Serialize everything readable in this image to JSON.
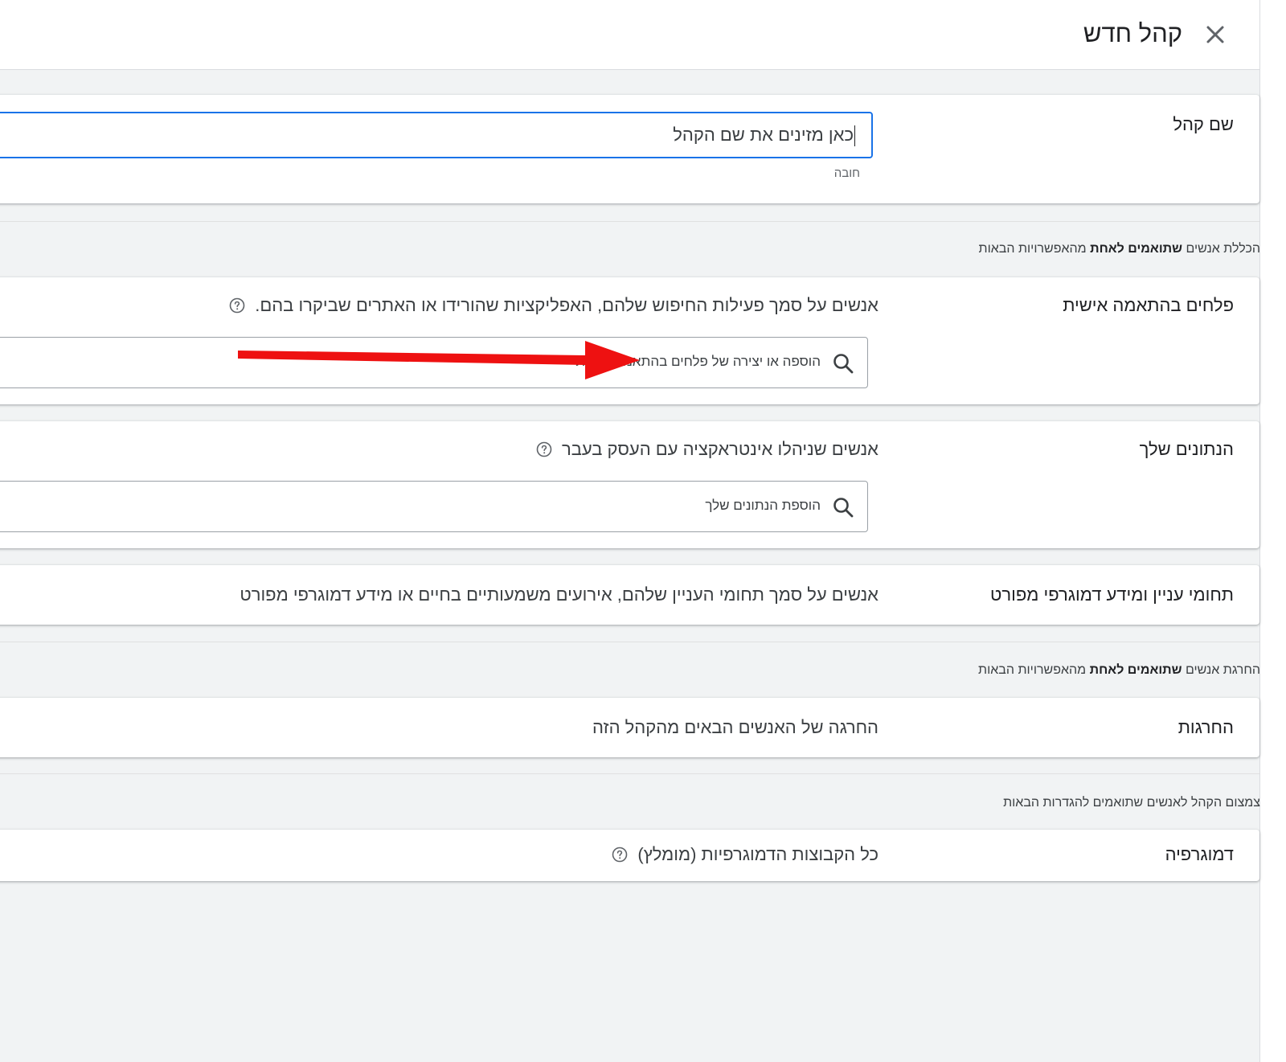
{
  "header": {
    "title": "קהל חדש",
    "close_icon": "close-icon"
  },
  "audience_name": {
    "label": "שם קהל",
    "value": "כאן מזינים את שם הקהל",
    "hint": "חובה"
  },
  "include_label": {
    "prefix": "הכללת אנשים ",
    "bold": "שתואמים לאחת",
    "suffix": " מהאפשרויות הבאות"
  },
  "custom_segments": {
    "title": "פלחים בהתאמה אישית",
    "description": "אנשים על סמך פעילות החיפוש שלהם, האפליקציות שהורידו או האתרים שביקרו בהם.",
    "search_placeholder": "הוספה או יצירה של פלחים בהתאמה אישית"
  },
  "your_data": {
    "title": "הנתונים שלך",
    "description": "אנשים שניהלו אינטראקציה עם העסק בעבר",
    "search_placeholder": "הוספת הנתונים שלך"
  },
  "interests": {
    "title": "תחומי עניין ומידע דמוגרפי מפורט",
    "description": "אנשים על סמך תחומי העניין שלהם, אירועים משמעותיים בחיים או מידע דמוגרפי מפורט"
  },
  "exclude_label": {
    "prefix": "החרגת אנשים ",
    "bold": "שתואמים לאחת",
    "suffix": " מהאפשרויות הבאות"
  },
  "exclusions": {
    "title": "החרגות",
    "description": "החרגה של האנשים הבאים מהקהל הזה"
  },
  "narrow_label": {
    "text": "צמצום הקהל לאנשים שתואמים להגדרות הבאות"
  },
  "demographics": {
    "title": "דמוגרפיה",
    "description": "כל הקבוצות הדמוגרפיות (מומלץ)"
  },
  "colors": {
    "accent": "#1a73e8",
    "annotation_arrow": "#ee1111",
    "background": "#f1f3f4"
  }
}
